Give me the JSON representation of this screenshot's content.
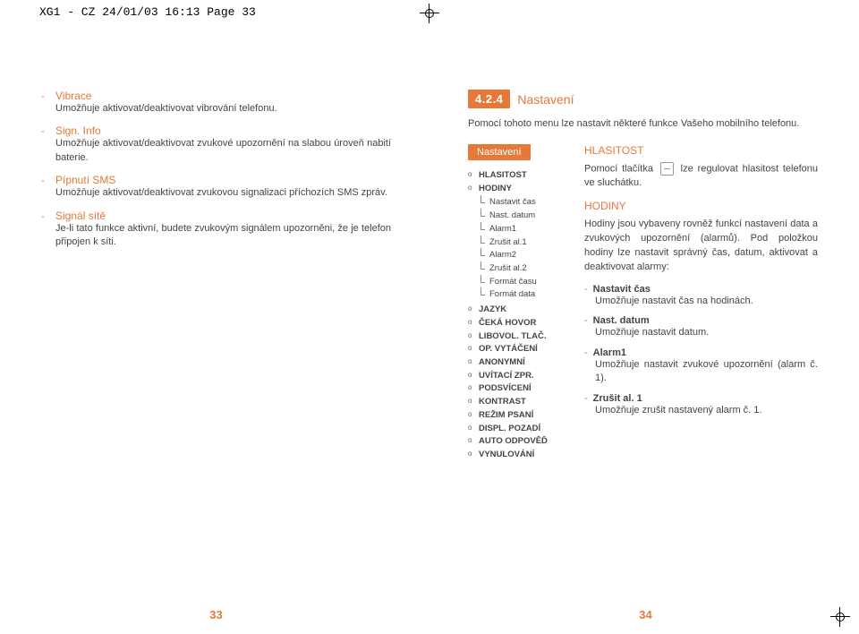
{
  "header": "XG1 - CZ  24/01/03  16:13  Page 33",
  "left_page": {
    "features": [
      {
        "title": "Vibrace",
        "desc": "Umožňuje aktivovat/deaktivovat vibrování telefonu."
      },
      {
        "title": "Sign. Info",
        "desc": "Umožňuje aktivovat/deaktivovat zvukové upozornění na slabou úroveň nabití baterie."
      },
      {
        "title": "Pípnutí SMS",
        "desc": "Umožňuje aktivovat/deaktivovat zvukovou signalizaci příchozích SMS zpráv."
      },
      {
        "title": "Signál sítě",
        "desc": "Je-li tato funkce aktivní, budete zvukovým signálem upozorněni, že je telefon připojen k síti."
      }
    ],
    "page_num": "33"
  },
  "right_page": {
    "section_num": "4.2.4",
    "section_title": "Nastavení",
    "intro": "Pomocí tohoto menu lze nastavit některé funkce Vašeho mobilního telefonu.",
    "menu_header": "Nastavení",
    "menu": [
      {
        "label": "HLASITOST"
      },
      {
        "label": "HODINY",
        "sub": [
          "Nastavit čas",
          "Nast. datum",
          "Alarm1",
          "Zrušit al.1",
          "Alarm2",
          "Zrušit al.2",
          "Formát času",
          "Formát data"
        ]
      },
      {
        "label": "JAZYK"
      },
      {
        "label": "ČEKÁ HOVOR"
      },
      {
        "label": "LIBOVOL. TLAČ."
      },
      {
        "label": "OP. VYTÁČENÍ"
      },
      {
        "label": "ANONYMNÍ"
      },
      {
        "label": "UVÍTACÍ ZPR."
      },
      {
        "label": "PODSVÍCENÍ"
      },
      {
        "label": "KONTRAST"
      },
      {
        "label": "REŽIM PSANÍ"
      },
      {
        "label": "DISPL. POZADÍ"
      },
      {
        "label": "AUTO ODPOVĚĎ"
      },
      {
        "label": "VYNULOVÁNÍ"
      }
    ],
    "h_hlasitost": "HLASITOST",
    "p_hlasitost_a": "Pomocí tlačítka",
    "p_hlasitost_b": "lze regulovat hlasitost telefonu ve sluchátku.",
    "h_hodiny": "HODINY",
    "p_hodiny": "Hodiny jsou vybaveny rovněž funkcí nastavení data a zvukových upozornění (alarmů). Pod položkou hodiny lze nastavit správný čas, datum, aktivovat a deaktivovat alarmy:",
    "subs": [
      {
        "t": "Nastavit čas",
        "d": "Umožňuje nastavit čas na hodinách."
      },
      {
        "t": "Nast. datum",
        "d": "Umožňuje nastavit datum."
      },
      {
        "t": "Alarm1",
        "d": "Umožňuje nastavit zvukové upozornění (alarm č. 1)."
      },
      {
        "t": "Zrušit al. 1",
        "d": "Umožňuje zrušit nastavený alarm č. 1."
      }
    ],
    "page_num": "34"
  }
}
